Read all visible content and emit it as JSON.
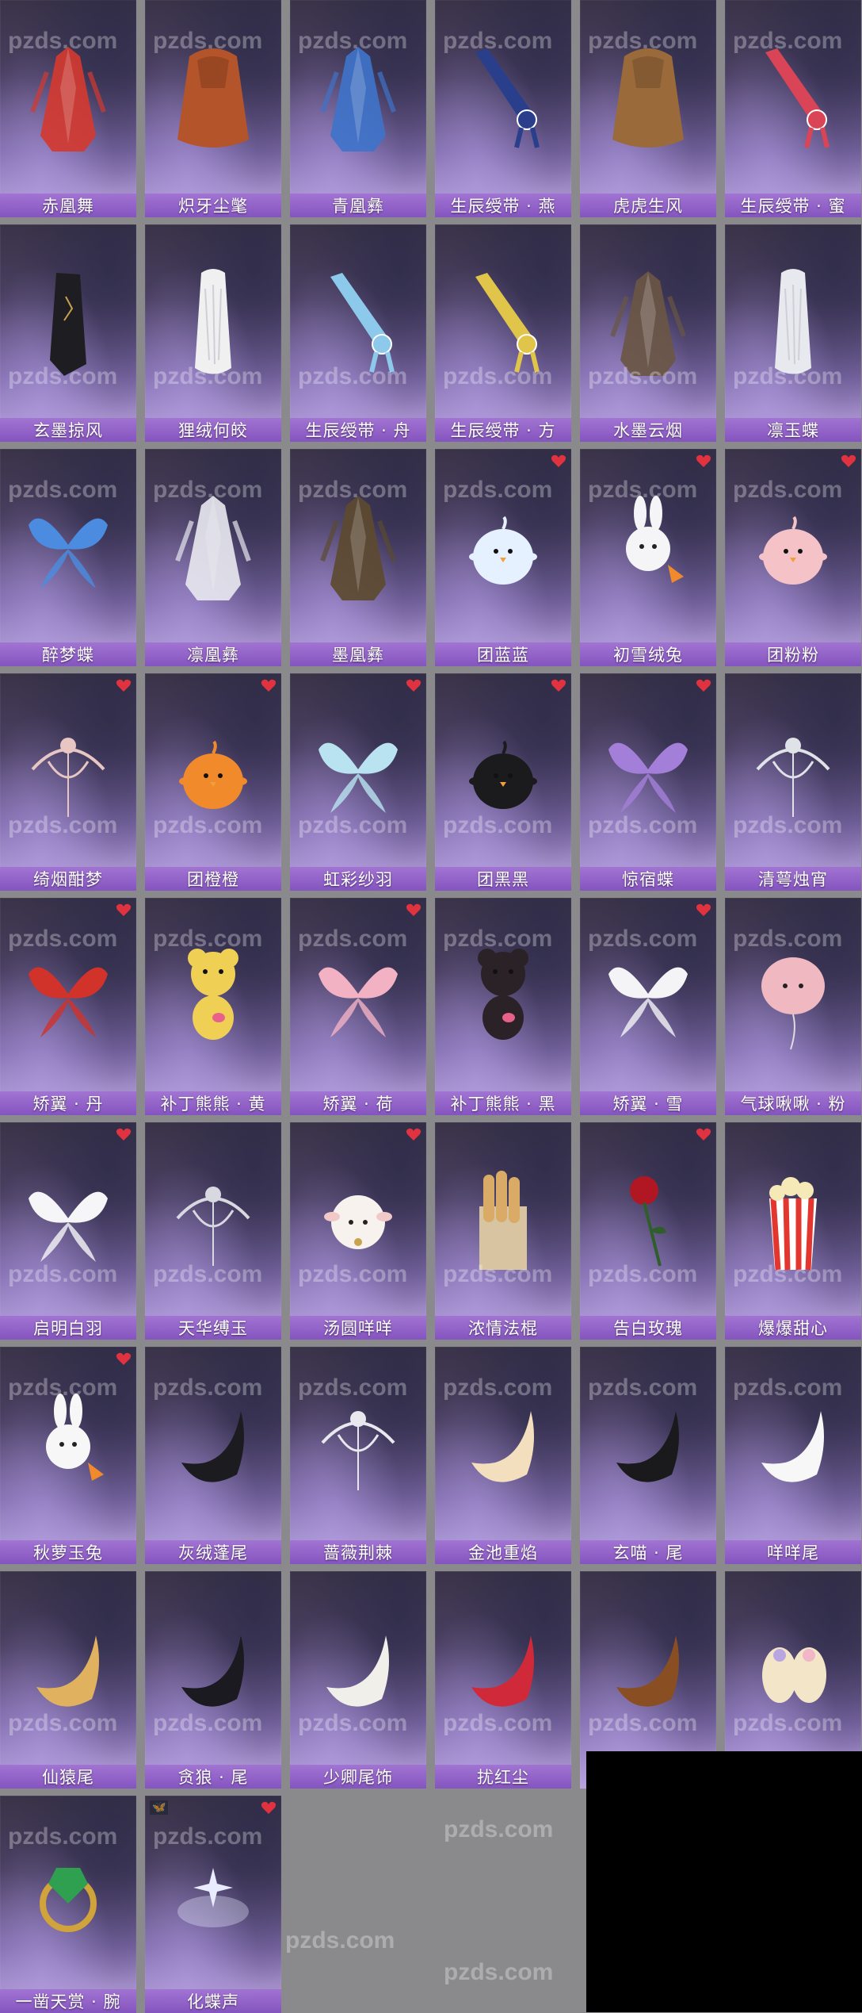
{
  "watermark": "pzds.com",
  "items": [
    {
      "label": "赤凰舞",
      "kind": "robe",
      "color": "#d23a30",
      "fav": false
    },
    {
      "label": "炽牙尘氅",
      "kind": "cape",
      "color": "#b4542a",
      "fav": false
    },
    {
      "label": "青凰彝",
      "kind": "robe",
      "color": "#3f73c9",
      "fav": false
    },
    {
      "label": "生辰绶带 · 燕",
      "kind": "sash",
      "color": "#2a3f8c",
      "fav": false
    },
    {
      "label": "虎虎生风",
      "kind": "cape",
      "color": "#9a6a3a",
      "fav": false
    },
    {
      "label": "生辰绶带 · 蜜",
      "kind": "sash",
      "color": "#d94456",
      "fav": false
    },
    {
      "label": "玄墨掠风",
      "kind": "cloak",
      "color": "#1e1e22",
      "fav": false
    },
    {
      "label": "狸绒何皎",
      "kind": "fur",
      "color": "#f0f0f0",
      "fav": false
    },
    {
      "label": "生辰绶带 · 舟",
      "kind": "sash",
      "color": "#8cc9ea",
      "fav": false
    },
    {
      "label": "生辰绶带 · 方",
      "kind": "sash",
      "color": "#e1c44a",
      "fav": false
    },
    {
      "label": "水墨云烟",
      "kind": "robe",
      "color": "#6a5644",
      "fav": false
    },
    {
      "label": "凛玉蝶",
      "kind": "fur",
      "color": "#e8e8ef",
      "fav": false
    },
    {
      "label": "醉梦蝶",
      "kind": "wings",
      "color": "#4b8ce0",
      "fav": false
    },
    {
      "label": "凛凰彝",
      "kind": "robe",
      "color": "#e6e6ee",
      "fav": false
    },
    {
      "label": "墨凰彝",
      "kind": "robe",
      "color": "#5c4a30",
      "fav": false
    },
    {
      "label": "团蓝蓝",
      "kind": "chick",
      "color": "#e6f1ff",
      "fav": true
    },
    {
      "label": "初雪绒兔",
      "kind": "rabbit",
      "color": "#f5f5f7",
      "fav": true
    },
    {
      "label": "团粉粉",
      "kind": "chick",
      "color": "#f4c2c7",
      "fav": true
    },
    {
      "label": "绮烟酣梦",
      "kind": "ribbon",
      "color": "#e8c6c3",
      "fav": true
    },
    {
      "label": "团橙橙",
      "kind": "chick",
      "color": "#f08a2a",
      "fav": true
    },
    {
      "label": "虹彩纱羽",
      "kind": "wings",
      "color": "#b9e3f0",
      "fav": true
    },
    {
      "label": "团黑黑",
      "kind": "chick",
      "color": "#1b1b1e",
      "fav": true
    },
    {
      "label": "惊宿蝶",
      "kind": "wings",
      "color": "#a47fd9",
      "fav": true
    },
    {
      "label": "清萼烛宵",
      "kind": "ribbon",
      "color": "#dfe2e6",
      "fav": false
    },
    {
      "label": "矫翼 · 丹",
      "kind": "wings",
      "color": "#d1322a",
      "fav": true
    },
    {
      "label": "补丁熊熊 · 黄",
      "kind": "bear",
      "color": "#f0cf55",
      "fav": false
    },
    {
      "label": "矫翼 · 荷",
      "kind": "wings",
      "color": "#f2b2c4",
      "fav": true
    },
    {
      "label": "补丁熊熊 · 黑",
      "kind": "bear",
      "color": "#2a2226",
      "fav": false
    },
    {
      "label": "矫翼 · 雪",
      "kind": "wings",
      "color": "#f4f4f6",
      "fav": true
    },
    {
      "label": "气球啾啾 · 粉",
      "kind": "balloon",
      "color": "#f0b9c2",
      "fav": false
    },
    {
      "label": "启明白羽",
      "kind": "wings",
      "color": "#f6f6f8",
      "fav": true
    },
    {
      "label": "天华缚玉",
      "kind": "ribbon",
      "color": "#d8d8e0",
      "fav": false
    },
    {
      "label": "汤圆咩咩",
      "kind": "sheep",
      "color": "#f7f2ee",
      "fav": true
    },
    {
      "label": "浓情法棍",
      "kind": "bread",
      "color": "#d9ab66",
      "fav": false
    },
    {
      "label": "告白玫瑰",
      "kind": "rose",
      "color": "#b01722",
      "fav": true
    },
    {
      "label": "爆爆甜心",
      "kind": "popcorn",
      "color": "#e2362f",
      "fav": false
    },
    {
      "label": "秋萝玉兔",
      "kind": "rabbit",
      "color": "#f7f7f7",
      "fav": true
    },
    {
      "label": "灰绒蓬尾",
      "kind": "tail",
      "color": "#1c1c20",
      "fav": false
    },
    {
      "label": "蔷薇荆棘",
      "kind": "ribbon",
      "color": "#e8e8ee",
      "fav": false
    },
    {
      "label": "金池重焰",
      "kind": "tail",
      "color": "#f3dfbd",
      "fav": false
    },
    {
      "label": "玄喵 · 尾",
      "kind": "tail",
      "color": "#1a1a1c",
      "fav": false
    },
    {
      "label": "咩咩尾",
      "kind": "tail",
      "color": "#f7f7f7",
      "fav": false
    },
    {
      "label": "仙猿尾",
      "kind": "tail",
      "color": "#e0b25f",
      "fav": false
    },
    {
      "label": "贪狼 · 尾",
      "kind": "tail",
      "color": "#1a1a20",
      "fav": false
    },
    {
      "label": "少卿尾饰",
      "kind": "tail",
      "color": "#f1efe9",
      "fav": false
    },
    {
      "label": "扰红尘",
      "kind": "tail",
      "color": "#d02a3a",
      "fav": false
    },
    {
      "label": "",
      "kind": "tail",
      "color": "#8a4e23",
      "fav": false
    },
    {
      "label": "",
      "kind": "slippers",
      "color": "#f3e6c8",
      "fav": false
    },
    {
      "label": "一凿天赏 · 腕",
      "kind": "ring",
      "color": "#2fa04f",
      "fav": false
    },
    {
      "label": "化蝶声",
      "kind": "sparkle",
      "color": "#e9ecff",
      "fav": true,
      "tag": "🦋"
    }
  ]
}
